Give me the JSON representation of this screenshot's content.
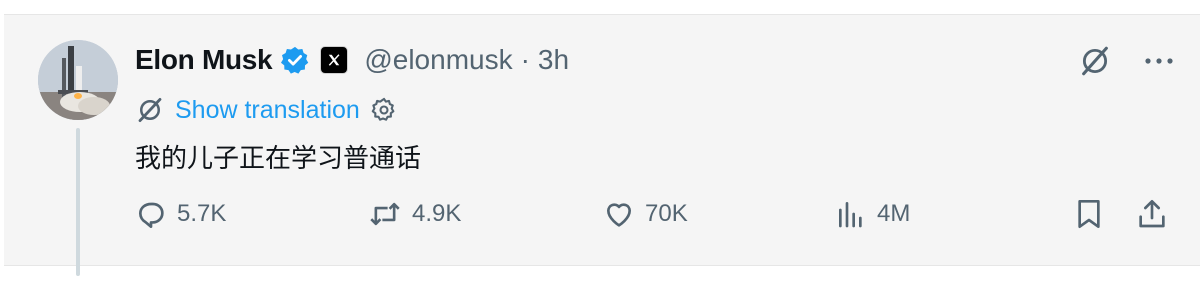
{
  "author": {
    "name": "Elon Musk",
    "handle": "@elonmusk",
    "separator": "·",
    "time": "3h"
  },
  "translation": {
    "label": "Show translation"
  },
  "tweet": {
    "text": "我的儿子正在学习普通话"
  },
  "actions": {
    "replies": "5.7K",
    "reposts": "4.9K",
    "likes": "70K",
    "views": "4M"
  },
  "icons": {
    "verified": "verified-badge-icon",
    "affiliate": "x-logo-icon",
    "grok": "grok-icon",
    "more": "more-icon",
    "translate": "grok-translate-icon",
    "settings": "gear-icon",
    "reply": "reply-icon",
    "repost": "repost-icon",
    "like": "heart-icon",
    "views": "views-icon",
    "bookmark": "bookmark-icon",
    "share": "share-icon"
  },
  "colors": {
    "accent": "#1d9bf0",
    "muted": "#536471",
    "text": "#0f1419",
    "background": "#f5f5f5"
  }
}
